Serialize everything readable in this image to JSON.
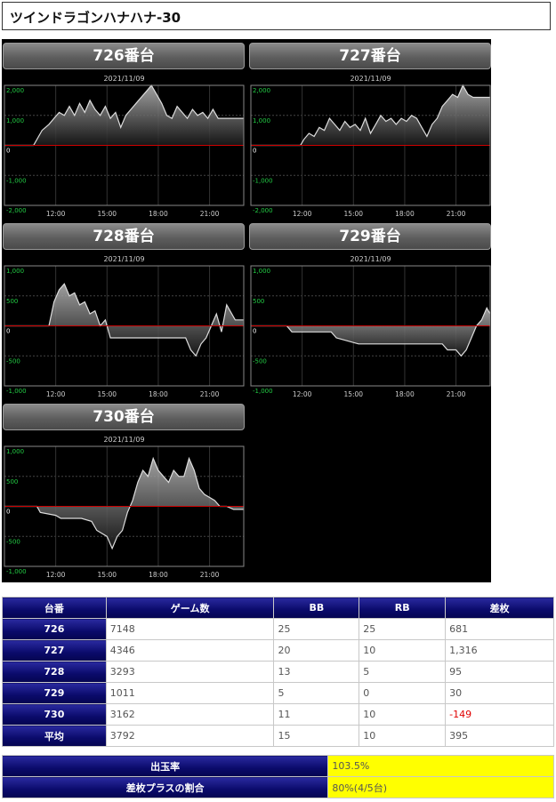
{
  "page_title": "ツインドラゴンハナハナ-30",
  "chart_data": [
    {
      "type": "line",
      "title": "726番台",
      "subtitle": "2021/11/09",
      "yticks": [
        "2,000",
        "1,000",
        "0",
        "-1,000",
        "-2,000"
      ],
      "ylim": [
        -2000,
        2000
      ],
      "xticks": [
        "12:00",
        "15:00",
        "18:00",
        "21:00"
      ],
      "xlim": [
        9,
        23
      ],
      "x": [
        9,
        10.7,
        11.2,
        11.6,
        11.9,
        12.2,
        12.5,
        12.8,
        13.1,
        13.4,
        13.7,
        14,
        14.3,
        14.6,
        14.9,
        15.2,
        15.5,
        15.8,
        16.1,
        16.4,
        16.7,
        17,
        17.3,
        17.6,
        17.9,
        18.2,
        18.5,
        18.8,
        19.1,
        19.4,
        19.7,
        20,
        20.3,
        20.6,
        20.9,
        21.2,
        21.5,
        22,
        23
      ],
      "y": [
        0,
        0,
        500,
        700,
        900,
        1100,
        1000,
        1300,
        1000,
        1400,
        1100,
        1500,
        1200,
        1000,
        1300,
        900,
        1100,
        600,
        1000,
        1200,
        1400,
        1600,
        1800,
        2000,
        1700,
        1400,
        1000,
        900,
        1300,
        1100,
        900,
        1200,
        1000,
        1100,
        900,
        1200,
        900,
        900,
        900
      ]
    },
    {
      "type": "line",
      "title": "727番台",
      "subtitle": "2021/11/09",
      "yticks": [
        "2,000",
        "1,000",
        "0",
        "-1,000",
        "-2,000"
      ],
      "ylim": [
        -2000,
        2000
      ],
      "xticks": [
        "12:00",
        "15:00",
        "18:00",
        "21:00"
      ],
      "xlim": [
        9,
        23
      ],
      "x": [
        9,
        11.9,
        12.1,
        12.4,
        12.7,
        13,
        13.3,
        13.6,
        13.9,
        14.2,
        14.5,
        14.8,
        15.1,
        15.4,
        15.7,
        16,
        16.3,
        16.6,
        16.9,
        17.2,
        17.5,
        17.8,
        18.1,
        18.4,
        18.7,
        19,
        19.3,
        19.6,
        19.9,
        20.2,
        20.5,
        20.8,
        21.1,
        21.4,
        21.7,
        22,
        23
      ],
      "y": [
        0,
        0,
        200,
        400,
        300,
        600,
        500,
        900,
        700,
        500,
        800,
        600,
        700,
        500,
        900,
        400,
        700,
        1000,
        800,
        900,
        700,
        900,
        800,
        1000,
        900,
        600,
        300,
        700,
        900,
        1300,
        1500,
        1700,
        1600,
        2000,
        1700,
        1600,
        1600
      ]
    },
    {
      "type": "line",
      "title": "728番台",
      "subtitle": "2021/11/09",
      "yticks": [
        "1,000",
        "500",
        "0",
        "-500",
        "-1,000"
      ],
      "ylim": [
        -1000,
        1000
      ],
      "xticks": [
        "12:00",
        "15:00",
        "18:00",
        "21:00"
      ],
      "xlim": [
        9,
        23
      ],
      "x": [
        9,
        11.6,
        11.9,
        12.2,
        12.5,
        12.8,
        13.1,
        13.4,
        13.7,
        14,
        14.3,
        14.6,
        14.9,
        15.2,
        15.5,
        17.8,
        19.6,
        19.9,
        20.2,
        20.5,
        20.8,
        21.1,
        21.4,
        21.7,
        22,
        22.5,
        23
      ],
      "y": [
        0,
        0,
        400,
        600,
        700,
        500,
        550,
        350,
        400,
        200,
        250,
        0,
        100,
        -200,
        -200,
        -200,
        -200,
        -400,
        -500,
        -300,
        -200,
        0,
        200,
        -100,
        350,
        100,
        100
      ]
    },
    {
      "type": "line",
      "title": "729番台",
      "subtitle": "2021/11/09",
      "yticks": [
        "1,000",
        "500",
        "0",
        "-500",
        "-1,000"
      ],
      "ylim": [
        -1000,
        1000
      ],
      "xticks": [
        "12:00",
        "15:00",
        "18:00",
        "21:00"
      ],
      "xlim": [
        9,
        23
      ],
      "x": [
        9,
        11.1,
        11.4,
        13.7,
        14,
        15.3,
        20.2,
        20.5,
        21,
        21.3,
        21.6,
        21.9,
        22.2,
        22.5,
        22.8,
        23
      ],
      "y": [
        0,
        0,
        -100,
        -100,
        -200,
        -300,
        -300,
        -400,
        -400,
        -500,
        -400,
        -200,
        0,
        100,
        300,
        200
      ]
    },
    {
      "type": "line",
      "title": "730番台",
      "subtitle": "2021/11/09",
      "yticks": [
        "1,000",
        "500",
        "0",
        "-500",
        "-1,000"
      ],
      "ylim": [
        -1000,
        1000
      ],
      "xticks": [
        "12:00",
        "15:00",
        "18:00",
        "21:00"
      ],
      "xlim": [
        9,
        23
      ],
      "x": [
        9,
        10.9,
        11.1,
        12,
        12.3,
        13.5,
        14.1,
        14.4,
        15,
        15.3,
        15.6,
        15.9,
        16.2,
        16.5,
        16.8,
        17.1,
        17.4,
        17.7,
        18,
        18.3,
        18.6,
        18.9,
        19.2,
        19.5,
        19.8,
        20.1,
        20.4,
        20.7,
        21.3,
        21.6,
        22,
        22.4,
        23
      ],
      "y": [
        0,
        0,
        -100,
        -150,
        -200,
        -200,
        -250,
        -400,
        -500,
        -700,
        -500,
        -400,
        -100,
        100,
        400,
        600,
        500,
        800,
        600,
        500,
        400,
        600,
        500,
        500,
        800,
        600,
        300,
        200,
        100,
        0,
        0,
        -50,
        -50
      ]
    }
  ],
  "table": {
    "headers": [
      "台番",
      "ゲーム数",
      "BB",
      "RB",
      "差枚"
    ],
    "rows": [
      {
        "id": "726",
        "games": "7148",
        "bb": "25",
        "rb": "25",
        "diff": "681"
      },
      {
        "id": "727",
        "games": "4346",
        "bb": "20",
        "rb": "10",
        "diff": "1,316"
      },
      {
        "id": "728",
        "games": "3293",
        "bb": "13",
        "rb": "5",
        "diff": "95"
      },
      {
        "id": "729",
        "games": "1011",
        "bb": "5",
        "rb": "0",
        "diff": "30"
      },
      {
        "id": "730",
        "games": "3162",
        "bb": "11",
        "rb": "10",
        "diff": "-149"
      },
      {
        "id": "平均",
        "games": "3792",
        "bb": "15",
        "rb": "10",
        "diff": "395"
      }
    ]
  },
  "summary": {
    "payout_label": "出玉率",
    "payout_value": "103.5%",
    "plus_label": "差枚プラスの割合",
    "plus_value": "80%(4/5台)"
  },
  "colors": {
    "zero_line": "#cc0000",
    "chart_bg": "#000000",
    "line": "#dddddd",
    "positive_tick": "#22cc44",
    "header_blue": "#0a0a6a",
    "highlight": "#ffff00",
    "negative": "#e00000"
  }
}
